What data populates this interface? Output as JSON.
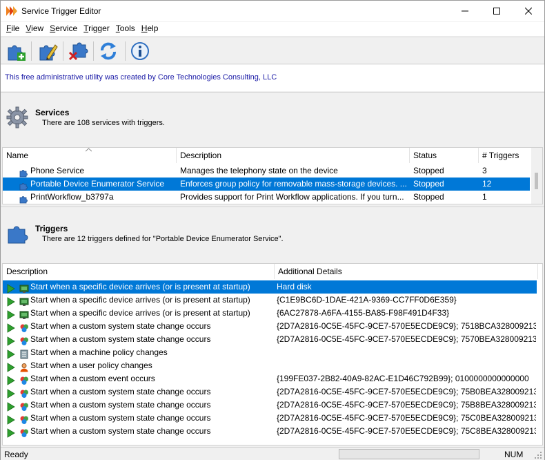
{
  "window": {
    "title": "Service Trigger Editor"
  },
  "menu": [
    {
      "pre": "",
      "u": "F",
      "post": "ile"
    },
    {
      "pre": "",
      "u": "V",
      "post": "iew"
    },
    {
      "pre": "",
      "u": "S",
      "post": "ervice"
    },
    {
      "pre": "",
      "u": "T",
      "post": "rigger"
    },
    {
      "pre": "",
      "u": "T",
      "post": "ools"
    },
    {
      "pre": "",
      "u": "H",
      "post": "elp"
    }
  ],
  "banner": {
    "text": "This free administrative utility was created by Core Technologies Consulting, LLC"
  },
  "services": {
    "title": "Services",
    "subtitle": "There are 108 services with triggers.",
    "columns": {
      "name": "Name",
      "description": "Description",
      "status": "Status",
      "triggers": "# Triggers"
    },
    "rows": [
      {
        "name": "Phone Service",
        "description": "Manages the telephony state on the device",
        "status": "Stopped",
        "triggers": "3",
        "selected": false
      },
      {
        "name": "Portable Device Enumerator Service",
        "description": "Enforces group policy for removable mass-storage devices. ...",
        "status": "Stopped",
        "triggers": "12",
        "selected": true
      },
      {
        "name": "PrintWorkflow_b3797a",
        "description": "Provides support for Print Workflow applications. If you turn...",
        "status": "Stopped",
        "triggers": "1",
        "selected": false
      }
    ]
  },
  "triggers": {
    "title": "Triggers",
    "subtitle": "There are 12 triggers defined for \"Portable Device Enumerator Service\".",
    "columns": {
      "description": "Description",
      "details": "Additional Details"
    },
    "rows": [
      {
        "icon": "device-icon",
        "description": "Start when a specific device arrives (or is present at startup)",
        "details": "Hard disk",
        "selected": true
      },
      {
        "icon": "device-icon",
        "description": "Start when a specific device arrives (or is present at startup)",
        "details": "{C1E9BC6D-1DAE-421A-9369-CC7FF0D6E359}",
        "selected": false
      },
      {
        "icon": "device-icon",
        "description": "Start when a specific device arrives (or is present at startup)",
        "details": "{6AC27878-A6FA-4155-BA85-F98F491D4F33}",
        "selected": false
      },
      {
        "icon": "system-state-icon",
        "description": "Start when a custom system state change occurs",
        "details": "{2D7A2816-0C5E-45FC-9CE7-570E5ECDE9C9}; 7518BCA328009213",
        "selected": false
      },
      {
        "icon": "system-state-icon",
        "description": "Start when a custom system state change occurs",
        "details": "{2D7A2816-0C5E-45FC-9CE7-570E5ECDE9C9}; 7570BEA328009213",
        "selected": false
      },
      {
        "icon": "machine-policy-icon",
        "description": "Start when a machine policy changes",
        "details": "",
        "selected": false
      },
      {
        "icon": "user-policy-icon",
        "description": "Start when a user policy changes",
        "details": "",
        "selected": false
      },
      {
        "icon": "system-state-icon",
        "description": "Start when a custom event occurs",
        "details": "{199FE037-2B82-40A9-82AC-E1D46C792B99}; 0100000000000000",
        "selected": false
      },
      {
        "icon": "system-state-icon",
        "description": "Start when a custom system state change occurs",
        "details": "{2D7A2816-0C5E-45FC-9CE7-570E5ECDE9C9}; 75B0BEA328009213",
        "selected": false
      },
      {
        "icon": "system-state-icon",
        "description": "Start when a custom system state change occurs",
        "details": "{2D7A2816-0C5E-45FC-9CE7-570E5ECDE9C9}; 75B8BEA328009213",
        "selected": false
      },
      {
        "icon": "system-state-icon",
        "description": "Start when a custom system state change occurs",
        "details": "{2D7A2816-0C5E-45FC-9CE7-570E5ECDE9C9}; 75C0BEA328009213",
        "selected": false
      },
      {
        "icon": "system-state-icon",
        "description": "Start when a custom system state change occurs",
        "details": "{2D7A2816-0C5E-45FC-9CE7-570E5ECDE9C9}; 75C8BEA328009213",
        "selected": false
      }
    ]
  },
  "status": {
    "text": "Ready",
    "num": "NUM"
  },
  "colors": {
    "selection": "#0078d7",
    "banner_text": "#1a1aa6",
    "play_green": "#2ea02e"
  }
}
